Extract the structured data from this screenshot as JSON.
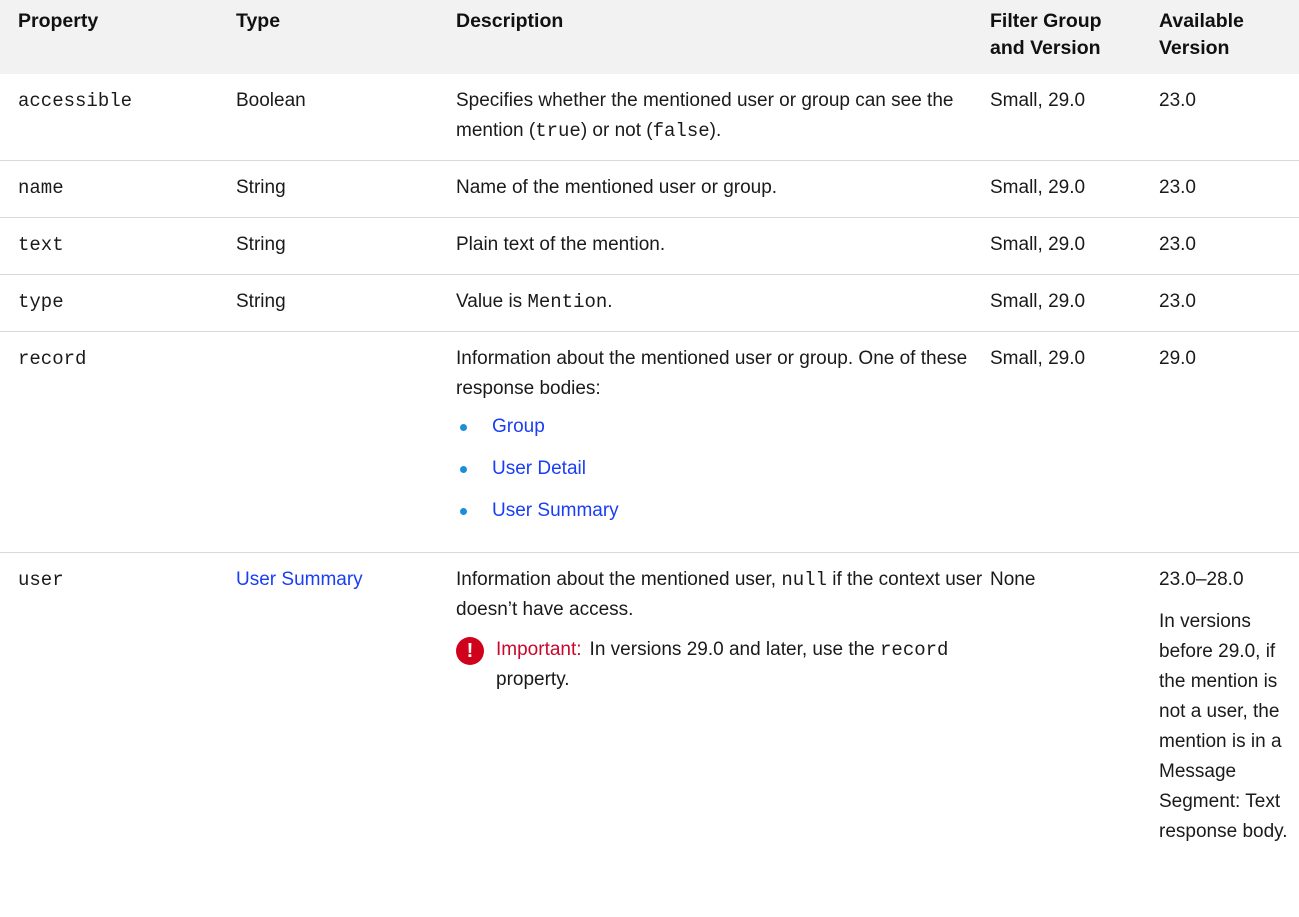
{
  "headers": {
    "property": "Property",
    "type": "Type",
    "description": "Description",
    "filter_line1": "Filter Group",
    "filter_line2": "and Version",
    "available_line1": "Available",
    "available_line2": "Version"
  },
  "rows": {
    "accessible": {
      "property": "accessible",
      "type": "Boolean",
      "desc_pre": "Specifies whether the mentioned user or group can see the mention (",
      "desc_code1": "true",
      "desc_mid": ") or not (",
      "desc_code2": "false",
      "desc_post": ").",
      "filter": "Small, 29.0",
      "version": "23.0"
    },
    "name": {
      "property": "name",
      "type": "String",
      "description": "Name of the mentioned user or group.",
      "filter": "Small, 29.0",
      "version": "23.0"
    },
    "text": {
      "property": "text",
      "type": "String",
      "description": "Plain text of the mention.",
      "filter": "Small, 29.0",
      "version": "23.0"
    },
    "type": {
      "property": "type",
      "type": "String",
      "desc_pre": "Value is ",
      "desc_code": "Mention",
      "desc_post": ".",
      "filter": "Small, 29.0",
      "version": "23.0"
    },
    "record": {
      "property": "record",
      "type": "",
      "description": "Information about the mentioned user or group. One of these response bodies:",
      "links": [
        "Group",
        "User Detail",
        "User Summary"
      ],
      "filter": "Small, 29.0",
      "version": "29.0"
    },
    "user": {
      "property": "user",
      "type_link": "User Summary",
      "desc_pre": "Information about the mentioned user, ",
      "desc_code": "null",
      "desc_post": " if the context user doesn’t have access.",
      "important_label": "Important:",
      "important_pre": "In versions 29.0 and later, use the ",
      "important_code": "record",
      "important_post": " property.",
      "important_icon": "exclamation-icon",
      "filter": "None",
      "version": "23.0–28.0",
      "version_note": "In versions before 29.0, if the mention is not a user, the mention is in a Message Segment: Text response body."
    }
  },
  "colors": {
    "header_bg": "#f2f2f2",
    "link": "#1a3ef5",
    "bullet": "#1a8fd8",
    "important": "#c9062c",
    "icon": "#d0021b"
  }
}
